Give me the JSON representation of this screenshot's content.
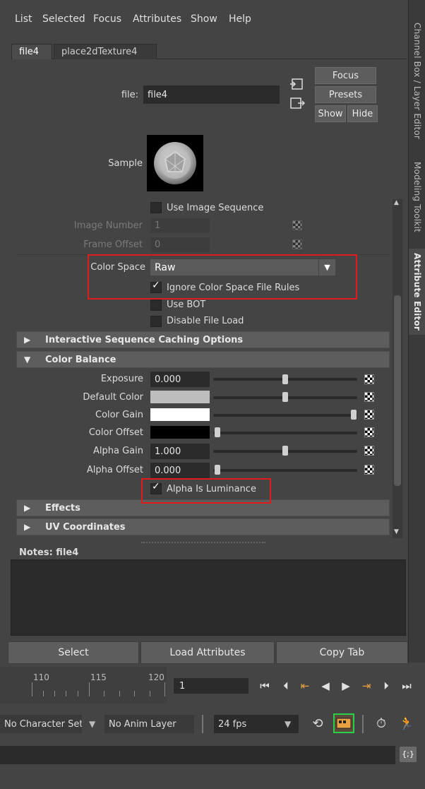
{
  "menu": [
    "List",
    "Selected",
    "Focus",
    "Attributes",
    "Show",
    "Help"
  ],
  "side_tabs": [
    "Channel Box / Layer Editor",
    "Modeling Toolkit",
    "Attribute Editor"
  ],
  "node_tabs": [
    "file4",
    "place2dTexture4"
  ],
  "file_label": "file:",
  "file_value": "file4",
  "buttons": {
    "focus": "Focus",
    "presets": "Presets",
    "show": "Show",
    "hide": "Hide"
  },
  "sample_label": "Sample",
  "use_image_sequence": "Use Image Sequence",
  "image_number": {
    "label": "Image Number",
    "value": "1"
  },
  "frame_offset": {
    "label": "Frame Offset",
    "value": "0"
  },
  "color_space": {
    "label": "Color Space",
    "value": "Raw"
  },
  "ignore_rules": "Ignore Color Space File Rules",
  "use_bot": "Use BOT",
  "disable_file_load": "Disable File Load",
  "sections": {
    "interactive": "Interactive Sequence Caching Options",
    "color_balance": "Color Balance",
    "effects": "Effects",
    "uv": "UV Coordinates"
  },
  "exposure": {
    "label": "Exposure",
    "value": "0.000"
  },
  "default_color": {
    "label": "Default Color",
    "swatch": "#bdbdbd"
  },
  "color_gain": {
    "label": "Color Gain",
    "swatch": "#ffffff"
  },
  "color_offset": {
    "label": "Color Offset",
    "swatch": "#000000"
  },
  "alpha_gain": {
    "label": "Alpha Gain",
    "value": "1.000"
  },
  "alpha_offset": {
    "label": "Alpha Offset",
    "value": "0.000"
  },
  "alpha_is_luminance": "Alpha Is Luminance",
  "notes_label": "Notes:  file4",
  "bottom_buttons": [
    "Select",
    "Load Attributes",
    "Copy Tab"
  ],
  "timeline_ticks": [
    "110",
    "115",
    "120"
  ],
  "current_frame": "1",
  "character_set": "No Character Set",
  "anim_layer": "No Anim Layer",
  "fps": "24 fps",
  "highlight_color": "#e11b1b"
}
